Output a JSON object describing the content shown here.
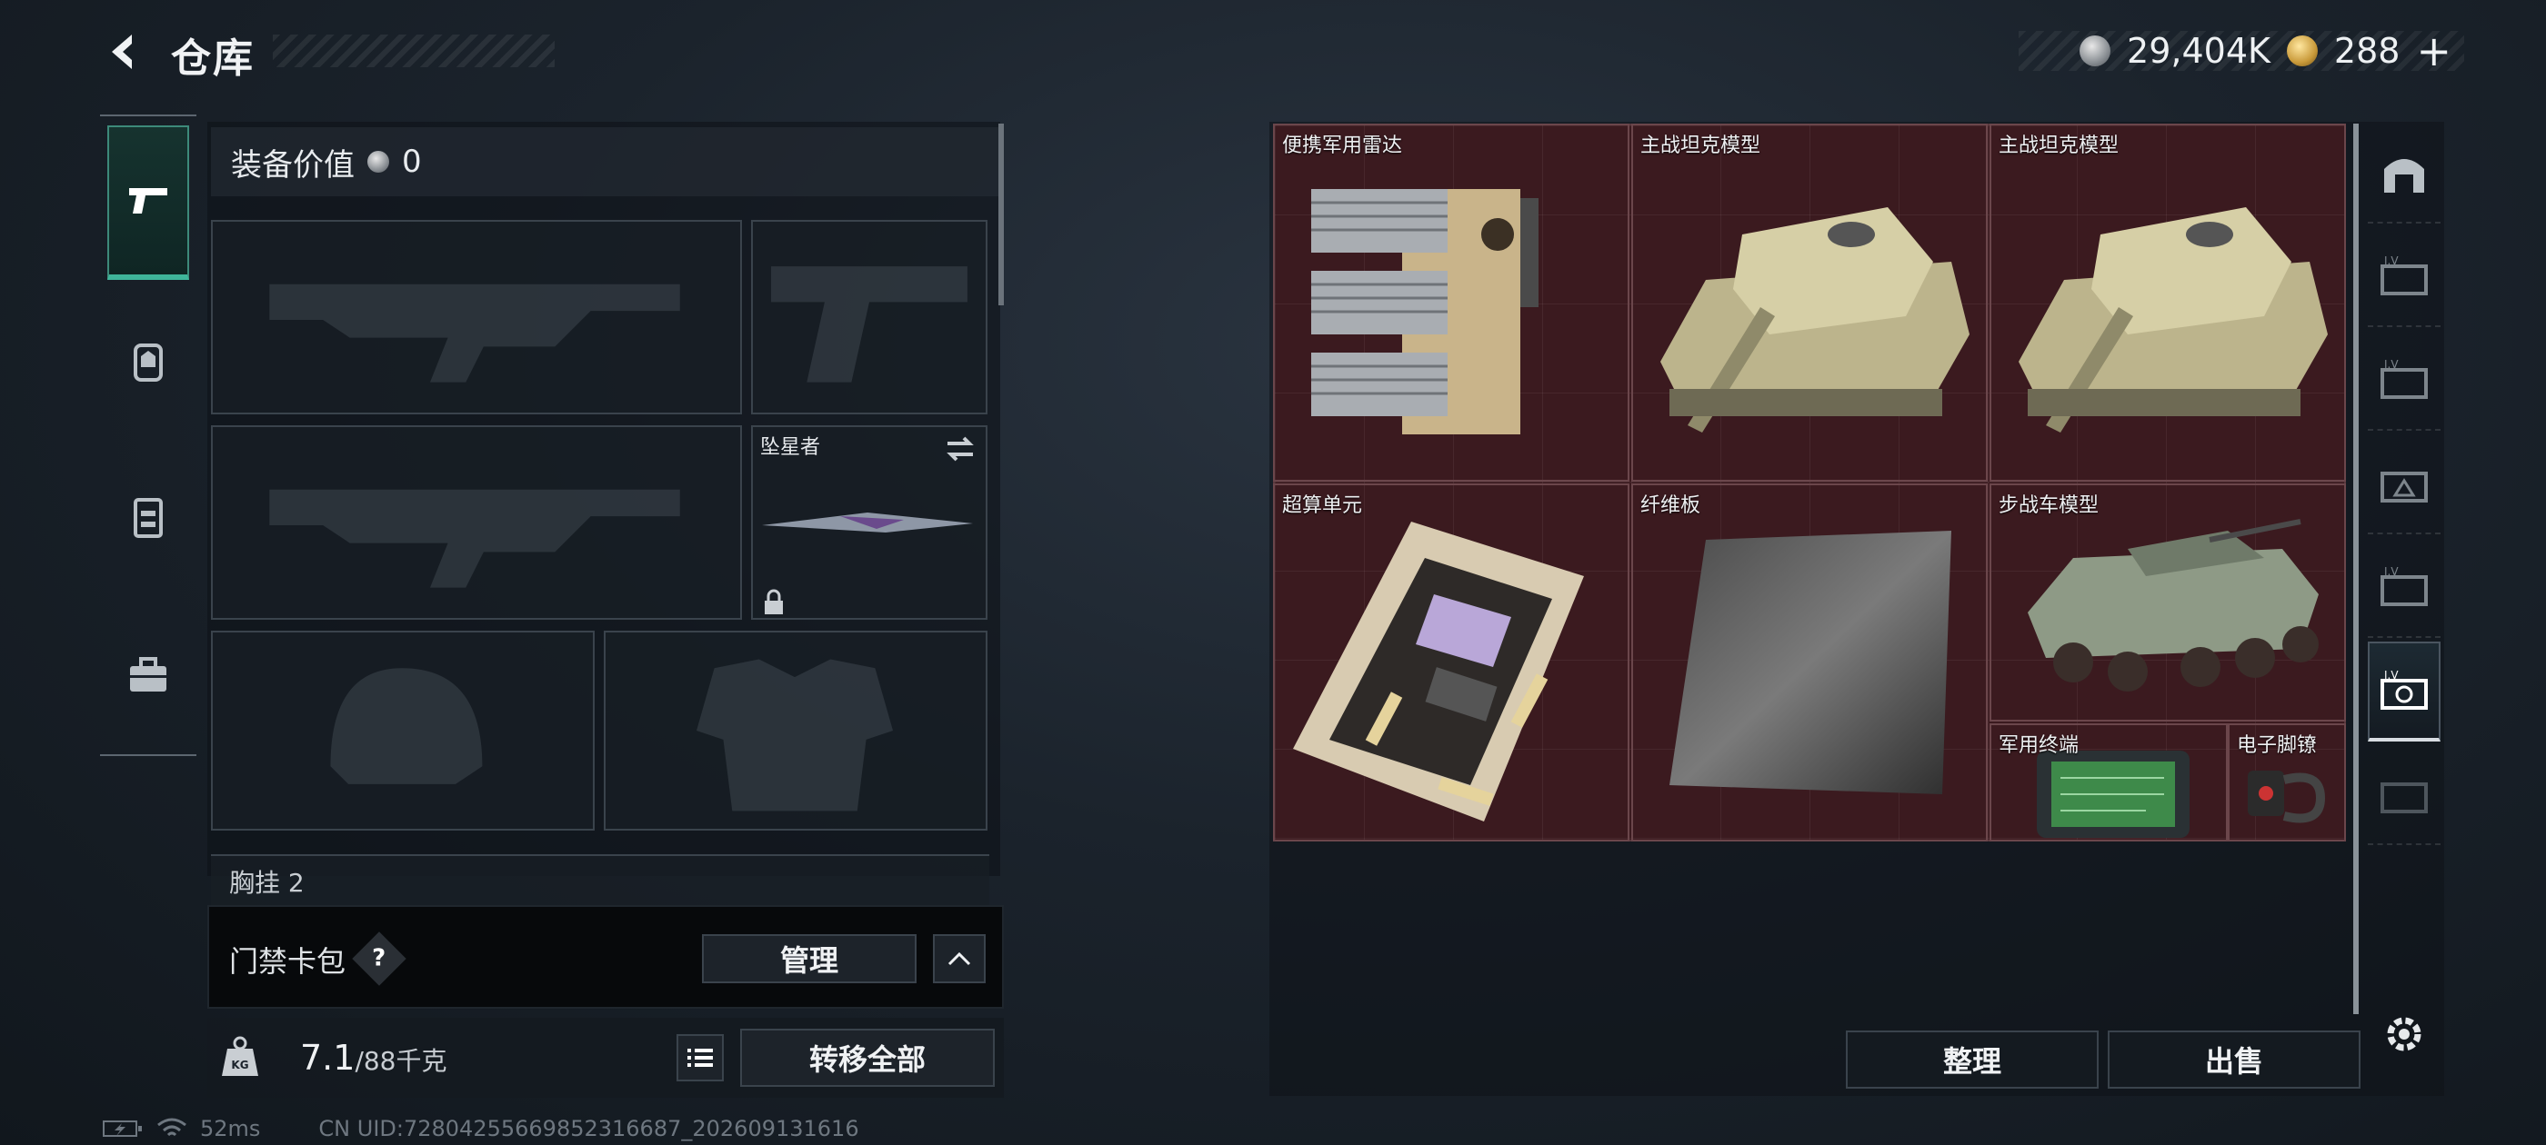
{
  "header": {
    "title": "仓库",
    "currency_silver": "29,404K",
    "currency_gold": "288"
  },
  "left_rail": {
    "tabs": [
      "pistol-icon",
      "backpack-icon",
      "vest-icon",
      "briefcase-icon"
    ]
  },
  "equipment": {
    "value_label": "装备价值",
    "value": "0",
    "melee_name": "坠星者",
    "chest_label": "胸挂",
    "chest_count": "2"
  },
  "keycard": {
    "label": "门禁卡包",
    "help": "?",
    "manage": "管理"
  },
  "weight": {
    "current": "7.1",
    "max": "/88千克",
    "icon_text": "KG"
  },
  "transfer_all": "转移全部",
  "status": {
    "ping": "52ms",
    "uid": "CN UID:7280425566985231668​7_202609131616"
  },
  "storage": {
    "items": [
      {
        "name": "便携军用雷达"
      },
      {
        "name": "主战坦克模型"
      },
      {
        "name": "主战坦克模型"
      },
      {
        "name": "超算单元"
      },
      {
        "name": "纤维板"
      },
      {
        "name": "步战车模型"
      },
      {
        "name": "军用终端"
      },
      {
        "name": "电子脚镣"
      }
    ],
    "sort": "整理",
    "sell": "出售"
  },
  "colors": {
    "accent_teal": "#3fb59a",
    "grid_bg": "#3b1a1f"
  }
}
